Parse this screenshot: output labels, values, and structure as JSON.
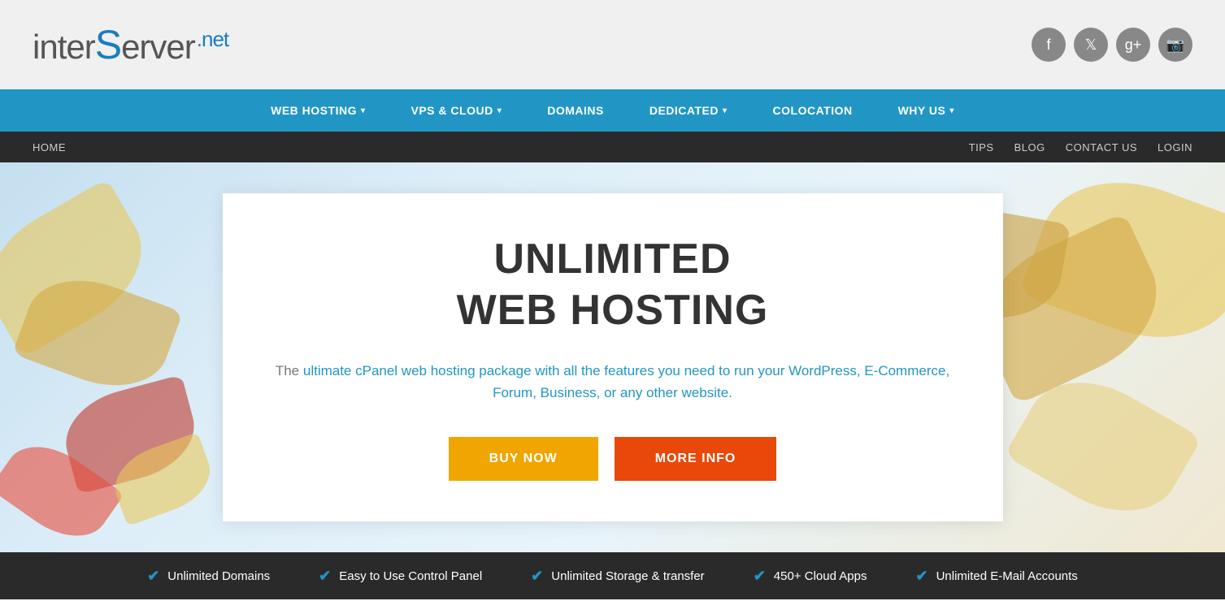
{
  "header": {
    "logo": {
      "inter": "inter",
      "s": "S",
      "erver": "erver",
      "net": ".net"
    },
    "social": [
      {
        "name": "facebook",
        "icon": "f"
      },
      {
        "name": "twitter",
        "icon": "t"
      },
      {
        "name": "googleplus",
        "icon": "g+"
      },
      {
        "name": "instagram",
        "icon": "📷"
      }
    ]
  },
  "nav": {
    "items": [
      {
        "label": "WEB HOSTING",
        "has_caret": true
      },
      {
        "label": "VPS & CLOUD",
        "has_caret": true
      },
      {
        "label": "DOMAINS",
        "has_caret": false
      },
      {
        "label": "DEDICATED",
        "has_caret": true
      },
      {
        "label": "COLOCATION",
        "has_caret": false
      },
      {
        "label": "WHY US",
        "has_caret": true
      }
    ]
  },
  "subnav": {
    "left": [
      {
        "label": "Home"
      }
    ],
    "right": [
      {
        "label": "TIPS"
      },
      {
        "label": "BLOG"
      },
      {
        "label": "CONTACT US"
      },
      {
        "label": "LOGIN"
      }
    ]
  },
  "hero": {
    "title_line1": "UNLIMITED",
    "title_line2": "WEB HOSTING",
    "subtitle": "The ultimate cPanel web hosting package with all the features you need to run your WordPress, E-Commerce, Forum, Business, or any other website.",
    "btn_buy": "BUY NOW",
    "btn_info": "MORE INFO"
  },
  "bottom_bar": {
    "features": [
      {
        "label": "Unlimited Domains"
      },
      {
        "label": "Easy to Use Control Panel"
      },
      {
        "label": "Unlimited Storage & transfer"
      },
      {
        "label": "450+ Cloud Apps"
      },
      {
        "label": "Unlimited E-Mail Accounts"
      }
    ]
  }
}
